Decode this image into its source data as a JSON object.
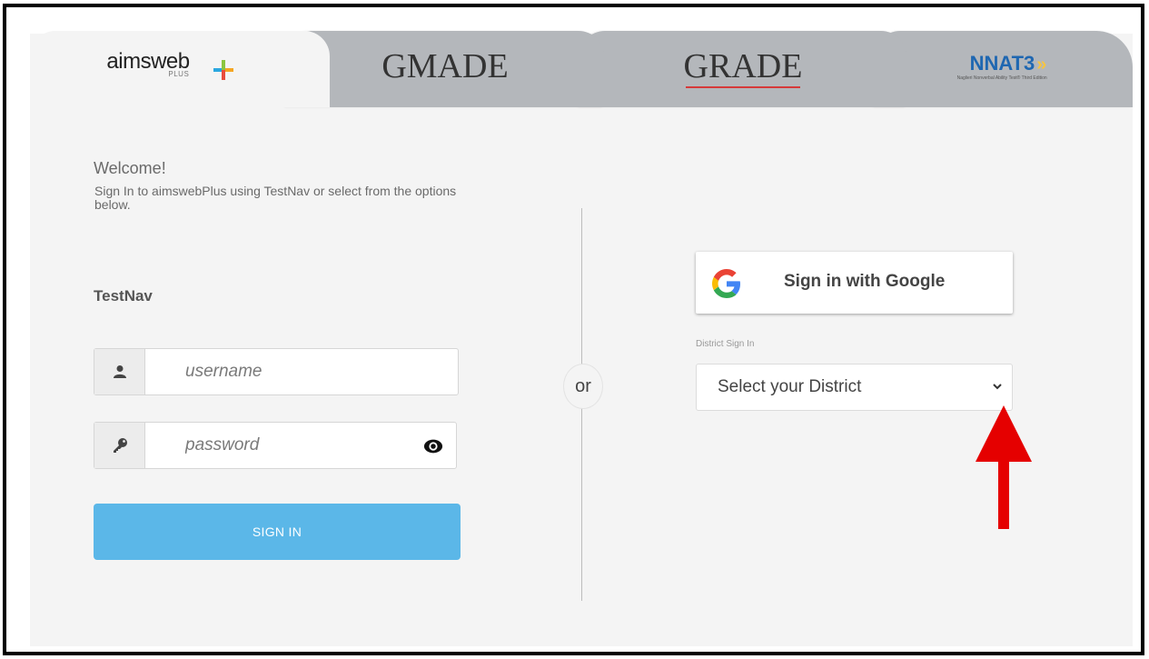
{
  "tabs": [
    {
      "label": "aimsweb",
      "sub": "PLUS",
      "active": true
    },
    {
      "label": "GMADE",
      "active": false
    },
    {
      "label": "GRADE",
      "active": false
    },
    {
      "label": "NNAT3",
      "sub": "Naglieri Nonverbal Ability Test® Third Edition",
      "active": false
    }
  ],
  "welcome": {
    "title": "Welcome!",
    "subtitle": "Sign In to aimswebPlus using TestNav or select from the options below."
  },
  "testnav": {
    "title": "TestNav",
    "username_placeholder": "username",
    "password_placeholder": "password",
    "signin_label": "SIGN IN"
  },
  "divider": {
    "or_label": "or"
  },
  "google": {
    "label": "Sign in with Google"
  },
  "district": {
    "label": "District Sign In",
    "selected": "Select your District"
  },
  "colors": {
    "signin_button": "#5bb7e8",
    "tab_inactive": "#b4b7bb",
    "panel_bg": "#f4f4f4",
    "annotation_arrow": "#e50000"
  },
  "icons": [
    "user-icon",
    "key-icon",
    "eye-icon",
    "google-g-icon",
    "chevron-down-icon",
    "annotation-arrow"
  ]
}
